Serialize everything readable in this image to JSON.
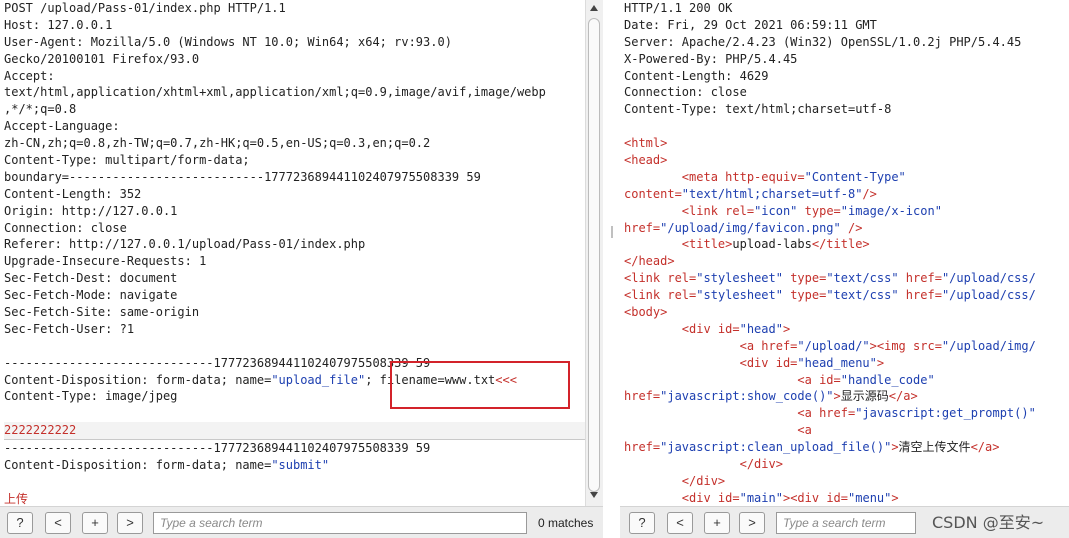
{
  "request": {
    "lines": [
      [
        {
          "t": "POST /upload/Pass-01/index.php HTTP/1.1",
          "c": "black"
        }
      ],
      [
        {
          "t": "Host: 127.0.0.1",
          "c": "black"
        }
      ],
      [
        {
          "t": "User-Agent: Mozilla/5.0 (Windows NT 10.0; Win64; x64; rv:93.0)",
          "c": "black"
        }
      ],
      [
        {
          "t": "Gecko/20100101 Firefox/93.0",
          "c": "black"
        }
      ],
      [
        {
          "t": "Accept:",
          "c": "black"
        }
      ],
      [
        {
          "t": "text/html,application/xhtml+xml,application/xml;q=0.9,image/avif,image/webp",
          "c": "black"
        }
      ],
      [
        {
          "t": ",*/*;q=0.8",
          "c": "black"
        }
      ],
      [
        {
          "t": "Accept-Language:",
          "c": "black"
        }
      ],
      [
        {
          "t": "zh-CN,zh;q=0.8,zh-TW;q=0.7,zh-HK;q=0.5,en-US;q=0.3,en;q=0.2",
          "c": "black"
        }
      ],
      [
        {
          "t": "Content-Type: multipart/form-data;",
          "c": "black"
        }
      ],
      [
        {
          "t": "boundary=---------------------------177723689441102407975508339 59",
          "c": "black"
        }
      ],
      [
        {
          "t": "Content-Length: 352",
          "c": "black"
        }
      ],
      [
        {
          "t": "Origin: http://127.0.0.1",
          "c": "black"
        }
      ],
      [
        {
          "t": "Connection: close",
          "c": "black"
        }
      ],
      [
        {
          "t": "Referer: http://127.0.0.1/upload/Pass-01/index.php",
          "c": "black"
        }
      ],
      [
        {
          "t": "Upgrade-Insecure-Requests: 1",
          "c": "black"
        }
      ],
      [
        {
          "t": "Sec-Fetch-Dest: document",
          "c": "black"
        }
      ],
      [
        {
          "t": "Sec-Fetch-Mode: navigate",
          "c": "black"
        }
      ],
      [
        {
          "t": "Sec-Fetch-Site: same-origin",
          "c": "black"
        }
      ],
      [
        {
          "t": "Sec-Fetch-User: ?1",
          "c": "black"
        }
      ],
      [
        {
          "t": "",
          "c": "black"
        }
      ],
      [
        {
          "t": "-----------------------------177723689441102407975508339 59",
          "c": "black"
        }
      ],
      [
        {
          "t": "Content-Disposition: form-data; name=",
          "c": "black"
        },
        {
          "t": "\"upload_file\"",
          "c": "blue"
        },
        {
          "t": "; filename=www.txt",
          "c": "black"
        },
        {
          "t": "<<<",
          "c": "red"
        }
      ],
      [
        {
          "t": "Content-Type: image/jpeg",
          "c": "black"
        }
      ],
      [
        {
          "t": "",
          "c": "black"
        }
      ],
      [
        {
          "t": "2222222222",
          "c": "red",
          "hl": true
        }
      ],
      [
        {
          "t": "-----------------------------177723689441102407975508339 59",
          "c": "black"
        }
      ],
      [
        {
          "t": "Content-Disposition: form-data; name=",
          "c": "black"
        },
        {
          "t": "\"submit\"",
          "c": "blue"
        }
      ],
      [
        {
          "t": "",
          "c": "black"
        }
      ],
      [
        {
          "t": "上传",
          "c": "red"
        }
      ]
    ]
  },
  "response": {
    "lines": [
      [
        {
          "t": "HTTP/1.1 200 OK",
          "c": "black"
        }
      ],
      [
        {
          "t": "Date: Fri, 29 Oct 2021 06:59:11 GMT",
          "c": "black"
        }
      ],
      [
        {
          "t": "Server: Apache/2.4.23 (Win32) OpenSSL/1.0.2j PHP/5.4.45",
          "c": "black"
        }
      ],
      [
        {
          "t": "X-Powered-By: PHP/5.4.45",
          "c": "black"
        }
      ],
      [
        {
          "t": "Content-Length: 4629",
          "c": "black"
        }
      ],
      [
        {
          "t": "Connection: close",
          "c": "black"
        }
      ],
      [
        {
          "t": "Content-Type: text/html;charset=utf-8",
          "c": "black"
        }
      ],
      [
        {
          "t": "",
          "c": "black"
        }
      ],
      [
        {
          "t": "<html>",
          "c": "red"
        }
      ],
      [
        {
          "t": "<head>",
          "c": "red"
        }
      ],
      [
        {
          "t": "        <meta ",
          "c": "red"
        },
        {
          "t": "http-equiv=",
          "c": "red"
        },
        {
          "t": "\"Content-Type\"",
          "c": "blue"
        }
      ],
      [
        {
          "t": "content=",
          "c": "red"
        },
        {
          "t": "\"text/html;charset=utf-8\"",
          "c": "blue"
        },
        {
          "t": "/>",
          "c": "red"
        }
      ],
      [
        {
          "t": "        <link ",
          "c": "red"
        },
        {
          "t": "rel=",
          "c": "red"
        },
        {
          "t": "\"icon\"",
          "c": "blue"
        },
        {
          "t": " type=",
          "c": "red"
        },
        {
          "t": "\"image/x-icon\"",
          "c": "blue"
        }
      ],
      [
        {
          "t": "href=",
          "c": "red"
        },
        {
          "t": "\"/upload/img/favicon.png\"",
          "c": "blue"
        },
        {
          "t": " />",
          "c": "red"
        }
      ],
      [
        {
          "t": "        <title>",
          "c": "red"
        },
        {
          "t": "upload-labs",
          "c": "black"
        },
        {
          "t": "</title>",
          "c": "red"
        }
      ],
      [
        {
          "t": "</head>",
          "c": "red"
        }
      ],
      [
        {
          "t": "<link ",
          "c": "red"
        },
        {
          "t": "rel=",
          "c": "red"
        },
        {
          "t": "\"stylesheet\"",
          "c": "blue"
        },
        {
          "t": " type=",
          "c": "red"
        },
        {
          "t": "\"text/css\"",
          "c": "blue"
        },
        {
          "t": " href=",
          "c": "red"
        },
        {
          "t": "\"/upload/css/",
          "c": "blue"
        }
      ],
      [
        {
          "t": "<link ",
          "c": "red"
        },
        {
          "t": "rel=",
          "c": "red"
        },
        {
          "t": "\"stylesheet\"",
          "c": "blue"
        },
        {
          "t": " type=",
          "c": "red"
        },
        {
          "t": "\"text/css\"",
          "c": "blue"
        },
        {
          "t": " href=",
          "c": "red"
        },
        {
          "t": "\"/upload/css/",
          "c": "blue"
        }
      ],
      [
        {
          "t": "<body>",
          "c": "red"
        }
      ],
      [
        {
          "t": "        <div ",
          "c": "red"
        },
        {
          "t": "id=",
          "c": "red"
        },
        {
          "t": "\"head\"",
          "c": "blue"
        },
        {
          "t": ">",
          "c": "red"
        }
      ],
      [
        {
          "t": "                <a ",
          "c": "red"
        },
        {
          "t": "href=",
          "c": "red"
        },
        {
          "t": "\"/upload/\"",
          "c": "blue"
        },
        {
          "t": "><img ",
          "c": "red"
        },
        {
          "t": "src=",
          "c": "red"
        },
        {
          "t": "\"/upload/img/",
          "c": "blue"
        }
      ],
      [
        {
          "t": "                <div ",
          "c": "red"
        },
        {
          "t": "id=",
          "c": "red"
        },
        {
          "t": "\"head_menu\"",
          "c": "blue"
        },
        {
          "t": ">",
          "c": "red"
        }
      ],
      [
        {
          "t": "                        <a ",
          "c": "red"
        },
        {
          "t": "id=",
          "c": "red"
        },
        {
          "t": "\"handle_code\"",
          "c": "blue"
        }
      ],
      [
        {
          "t": "href=",
          "c": "red"
        },
        {
          "t": "\"javascript:show_code()\"",
          "c": "blue"
        },
        {
          "t": ">",
          "c": "red"
        },
        {
          "t": "显示源码",
          "c": "black"
        },
        {
          "t": "</a>",
          "c": "red"
        }
      ],
      [
        {
          "t": "                        <a ",
          "c": "red"
        },
        {
          "t": "href=",
          "c": "red"
        },
        {
          "t": "\"javascript:get_prompt()\"",
          "c": "blue"
        }
      ],
      [
        {
          "t": "                        <a",
          "c": "red"
        }
      ],
      [
        {
          "t": "href=",
          "c": "red"
        },
        {
          "t": "\"javascript:clean_upload_file()\"",
          "c": "blue"
        },
        {
          "t": ">",
          "c": "red"
        },
        {
          "t": "清空上传文件",
          "c": "black"
        },
        {
          "t": "</a>",
          "c": "red"
        }
      ],
      [
        {
          "t": "                </div>",
          "c": "red"
        }
      ],
      [
        {
          "t": "        </div>",
          "c": "red"
        }
      ],
      [
        {
          "t": "        <div ",
          "c": "red"
        },
        {
          "t": "id=",
          "c": "red"
        },
        {
          "t": "\"main\"",
          "c": "blue"
        },
        {
          "t": "><div ",
          "c": "red"
        },
        {
          "t": "id=",
          "c": "red"
        },
        {
          "t": "\"menu\"",
          "c": "blue"
        },
        {
          "t": ">",
          "c": "red"
        }
      ]
    ]
  },
  "left_toolbar": {
    "help_label": "?",
    "prev_label": "<",
    "add_label": "+",
    "next_label": ">",
    "search_placeholder": "Type a search term",
    "matches": "0 matches"
  },
  "right_toolbar": {
    "help_label": "?",
    "prev_label": "<",
    "add_label": "+",
    "next_label": ">",
    "search_placeholder": "Type a search term"
  },
  "watermark": "CSDN @至安~",
  "colors": {
    "highlight_box": "#d3232a",
    "tag_red": "#c4302b",
    "attr_blue": "#1d3fb0"
  }
}
